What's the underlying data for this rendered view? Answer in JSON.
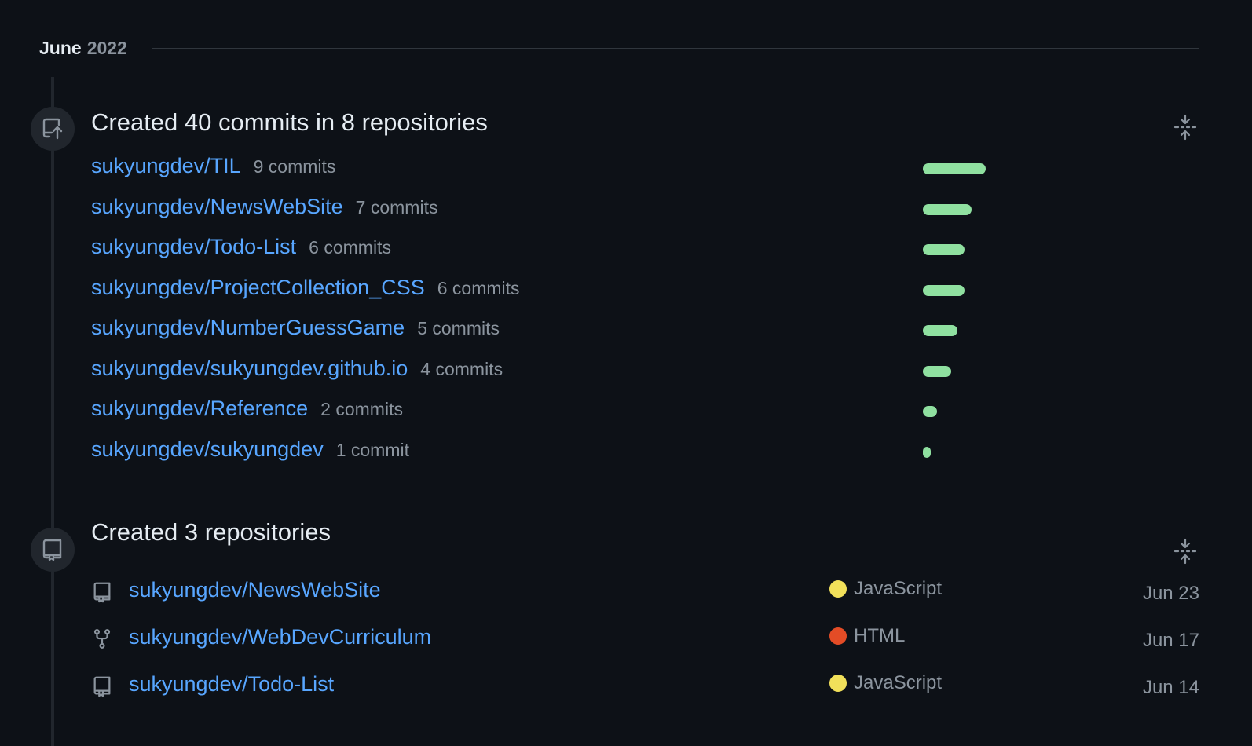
{
  "month_header": {
    "month": "June",
    "year": "2022"
  },
  "commits_section": {
    "title": "Created 40 commits in 8 repositories",
    "rows": [
      {
        "repo": "sukyungdev/TIL",
        "count_label": "9 commits",
        "commits": 9
      },
      {
        "repo": "sukyungdev/NewsWebSite",
        "count_label": "7 commits",
        "commits": 7
      },
      {
        "repo": "sukyungdev/Todo-List",
        "count_label": "6 commits",
        "commits": 6
      },
      {
        "repo": "sukyungdev/ProjectCollection_CSS",
        "count_label": "6 commits",
        "commits": 6
      },
      {
        "repo": "sukyungdev/NumberGuessGame",
        "count_label": "5 commits",
        "commits": 5
      },
      {
        "repo": "sukyungdev/sukyungdev.github.io",
        "count_label": "4 commits",
        "commits": 4
      },
      {
        "repo": "sukyungdev/Reference",
        "count_label": "2 commits",
        "commits": 2
      },
      {
        "repo": "sukyungdev/sukyungdev",
        "count_label": "1 commit",
        "commits": 1
      }
    ],
    "bar_color": "#8fe0a0"
  },
  "repos_section": {
    "title": "Created 3 repositories",
    "rows": [
      {
        "icon": "repo-icon",
        "repo": "sukyungdev/NewsWebSite",
        "language": "JavaScript",
        "language_color": "#f1e05a",
        "date": "Jun 23"
      },
      {
        "icon": "fork-icon",
        "repo": "sukyungdev/WebDevCurriculum",
        "language": "HTML",
        "language_color": "#e34c26",
        "date": "Jun 17"
      },
      {
        "icon": "repo-icon",
        "repo": "sukyungdev/Todo-List",
        "language": "JavaScript",
        "language_color": "#f1e05a",
        "date": "Jun 14"
      }
    ]
  },
  "colors": {
    "background": "#0d1117",
    "link": "#58a6ff",
    "muted": "#8b949e"
  }
}
